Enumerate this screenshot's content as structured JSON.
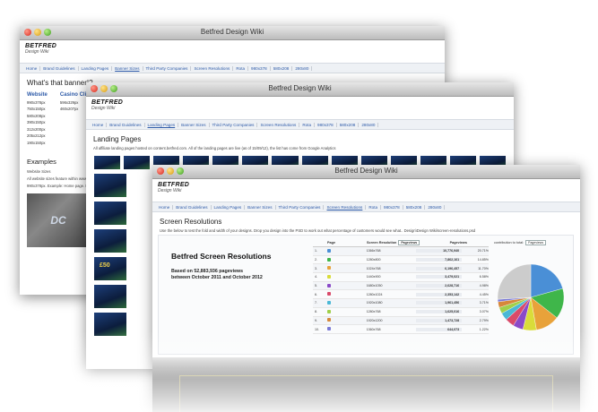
{
  "window1": {
    "title": "Betfred Design Wiki",
    "brand": "BETFRED",
    "brand_sub": "Design Wiki",
    "nav": [
      "Home",
      "Brand Guidelines",
      "Landing Pages",
      "Banner Sizes",
      "Third Party Companies",
      "Screen Resolutions",
      "Rota",
      "980x378",
      "580x208",
      "280x80"
    ],
    "active_nav": 3,
    "heading": "What's that banner!?",
    "col_website": "Website",
    "col_casino": "Casino Client",
    "website_sizes": [
      "990x378px",
      "750x150px",
      "580x208px",
      "390x150px",
      "312x200px",
      "205x212px",
      "190x150px"
    ],
    "casino_sizes": [
      "596x329px",
      "460x207px"
    ],
    "examples_heading": "Examples",
    "website_sizes_label": "Website Sizes",
    "website_sizes_note": "All website sizes feature within www.bet",
    "example_line": "990x378px. Example: Home page. Pla",
    "dc_logo": "DC"
  },
  "window2": {
    "title": "Betfred Design Wiki",
    "brand": "BETFRED",
    "brand_sub": "Design Wiki",
    "nav": [
      "Home",
      "Brand Guidelines",
      "Landing Pages",
      "Banner Sizes",
      "Third Party Companies",
      "Screen Resolutions",
      "Rota",
      "980x378",
      "580x208",
      "280x80"
    ],
    "active_nav": 2,
    "heading": "Landing Pages",
    "desc": "All affiliate landing pages hosted on content.betfred.com. All of the landing pages are live (as of 15/09/12), the list has come from Google Analytics",
    "thumb_label": "£50"
  },
  "window3": {
    "title": "Betfred Design Wiki",
    "brand": "BETFRED",
    "brand_sub": "Design Wiki",
    "nav": [
      "Home",
      "Brand Guidelines",
      "Landing Pages",
      "Banner Sizes",
      "Third Party Companies",
      "Screen Resolutions",
      "Rota",
      "980x378",
      "580x208",
      "280x80"
    ],
    "active_nav": 5,
    "heading": "Screen Resolutions",
    "desc": "Use the below to test the fold and width of your designs. Drop you design into the PSD to work out what percentage of customers would see what.. Design\\Design Wiki\\screen-resolutions.psd",
    "panel_title": "Betfred Screen Resolutions",
    "based_line1": "Based on 52,883,936 pageviews",
    "based_line2": "between October 2011 and October 2012",
    "table_head": {
      "page": "Page",
      "res": "Screen Resolution",
      "sel1": "Pageviews",
      "pv": "Pageviews",
      "contrib": "contribution to total:",
      "sel2": "Pageviews"
    },
    "rows": [
      {
        "n": "1.",
        "res": "1366x768",
        "pv": "10,776,940",
        "pc": "20.71%",
        "color": "#4a8fd6"
      },
      {
        "n": "2.",
        "res": "1280x800",
        "pv": "7,862,161",
        "pc": "14.85%",
        "color": "#3fb64a"
      },
      {
        "n": "3.",
        "res": "1024x768",
        "pv": "6,196,457",
        "pc": "11.70%",
        "color": "#e8a23a"
      },
      {
        "n": "4.",
        "res": "1440x900",
        "pv": "3,479,021",
        "pc": "6.58%",
        "color": "#d9dc3a"
      },
      {
        "n": "5.",
        "res": "1680x1050",
        "pv": "2,628,716",
        "pc": "4.98%",
        "color": "#8a4ac8"
      },
      {
        "n": "6.",
        "res": "1280x1024",
        "pv": "2,353,142",
        "pc": "4.45%",
        "color": "#d94a6a"
      },
      {
        "n": "7.",
        "res": "1920x1080",
        "pv": "1,961,456",
        "pc": "3.71%",
        "color": "#4ab8d6"
      },
      {
        "n": "8.",
        "res": "1280x768",
        "pv": "1,625,016",
        "pc": "3.07%",
        "color": "#a0d04a"
      },
      {
        "n": "9.",
        "res": "1920x1200",
        "pv": "1,473,728",
        "pc": "2.79%",
        "color": "#d6883a"
      },
      {
        "n": "10.",
        "res": "1360x768",
        "pv": "644,073",
        "pc": "1.22%",
        "color": "#7a7ad6"
      }
    ],
    "pie_colors": [
      "#4a8fd6",
      "#3fb64a",
      "#e8a23a",
      "#d9dc3a",
      "#8a4ac8",
      "#d94a6a",
      "#4ab8d6",
      "#a0d04a",
      "#d6883a",
      "#7a7ad6",
      "#cccccc"
    ],
    "pie_values": [
      20.71,
      14.85,
      11.7,
      6.58,
      4.98,
      4.45,
      3.71,
      3.07,
      2.79,
      1.22,
      25.94
    ]
  }
}
